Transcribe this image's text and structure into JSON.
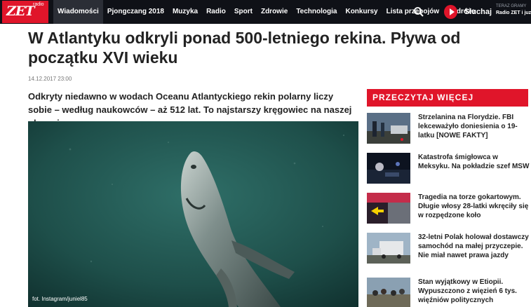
{
  "header": {
    "logo": {
      "word": "ZET",
      "sub": "radio"
    },
    "nav": [
      "Wiadomości",
      "Pjongczang 2018",
      "Muzyka",
      "Radio",
      "Sport",
      "Zdrowie",
      "Technologia",
      "Konkursy",
      "Lista przebojów",
      "Podróże"
    ],
    "listen_label": "Słuchaj",
    "now_playing_key": "TERAZ GRAMY",
    "now_playing_value": "Radio ZET i juz"
  },
  "article": {
    "title": "W Atlantyku odkryli ponad 500-letniego rekina. Pływa od początku XVI wieku",
    "date": "14.12.2017 23:00",
    "lead": "Odkryty niedawno w wodach Oceanu Atlantyckiego rekin polarny liczy sobie – według naukowców – aż 512 lat. To najstarszy kręgowiec na naszej planecie.",
    "photo_credit": "fot. Instagram/juniel85"
  },
  "sidebar": {
    "heading": "PRZECZYTAJ WIĘCEJ",
    "items": [
      {
        "title": "Strzelanina na Florydzie. FBI lekceważyło doniesienia o 19-latku [NOWE FAKTY]"
      },
      {
        "title": "Katastrofa śmigłowca w Meksyku. Na pokładzie szef MSW"
      },
      {
        "title": "Tragedia na torze gokartowym. Długie włosy 28-latki wkręciły się w rozpędzone koło"
      },
      {
        "title": "32-letni Polak holował dostawczy samochód na małej przyczepie. Nie miał nawet prawa jazdy"
      },
      {
        "title": "Stan wyjątkowy w Etiopii. Wypuszczono z więzień 6 tys. więźniów politycznych"
      }
    ]
  },
  "colors": {
    "accent": "#e0152a",
    "nav_bg": "#0f1117"
  }
}
